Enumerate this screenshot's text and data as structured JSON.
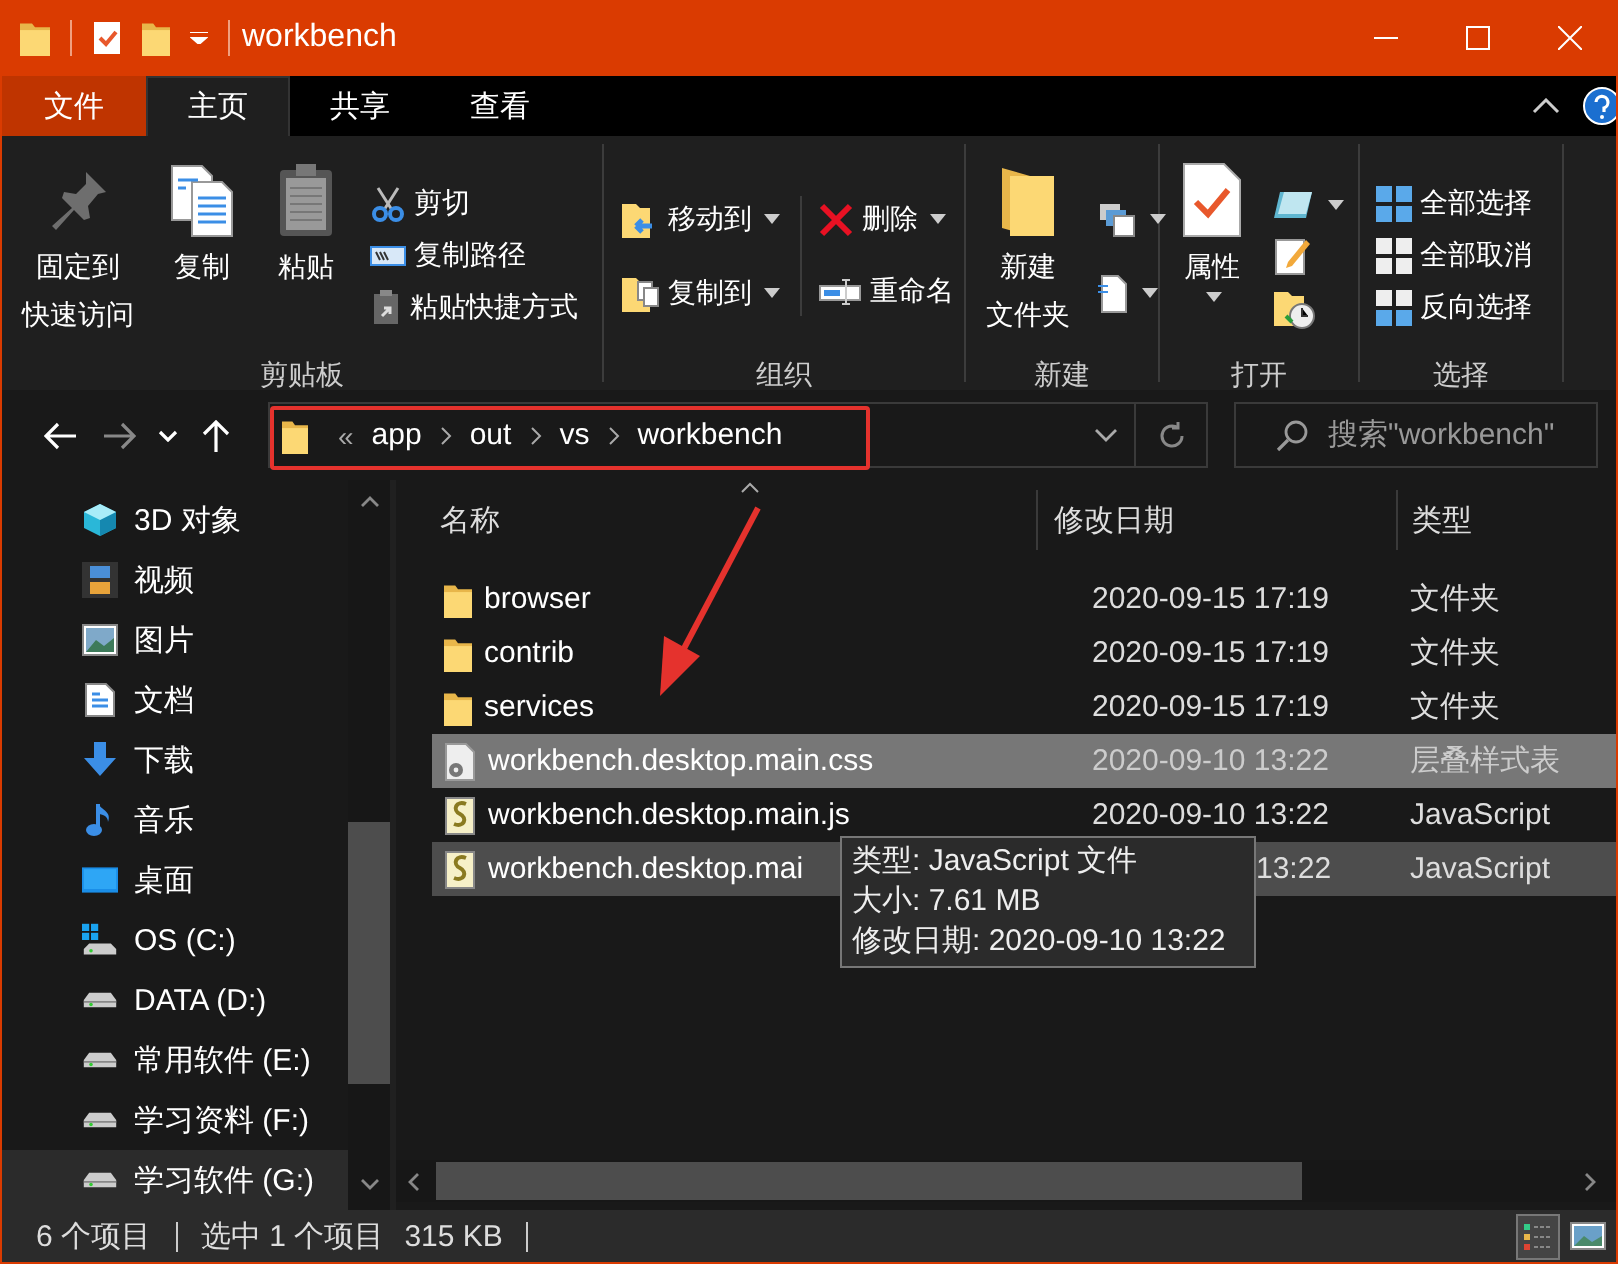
{
  "window": {
    "title": "workbench"
  },
  "ribbon_tabs": [
    {
      "label": "文件",
      "kind": "file",
      "selected": false
    },
    {
      "label": "主页",
      "kind": "tab",
      "selected": true
    },
    {
      "label": "共享",
      "kind": "tab",
      "selected": false
    },
    {
      "label": "查看",
      "kind": "tab",
      "selected": false
    }
  ],
  "ribbon_groups": [
    {
      "label": "剪贴板",
      "items": [
        {
          "kind": "large",
          "label": [
            "固定到",
            "快速访问"
          ],
          "dropdown": false
        },
        {
          "kind": "large",
          "label": [
            "复制"
          ],
          "dropdown": false
        },
        {
          "kind": "large",
          "label": [
            "粘贴"
          ],
          "dropdown": false
        },
        {
          "kind": "stack",
          "items": [
            {
              "label": "剪切",
              "dropdown": false
            },
            {
              "label": "复制路径",
              "dropdown": false
            },
            {
              "label": "粘贴快捷方式",
              "dropdown": false
            }
          ]
        }
      ]
    },
    {
      "label": "组织",
      "items": [
        {
          "kind": "stack",
          "items": [
            {
              "label": "移动到",
              "dropdown": true
            },
            {
              "label": "复制到",
              "dropdown": true
            }
          ]
        },
        {
          "kind": "stack",
          "items": [
            {
              "label": "删除",
              "dropdown": true
            },
            {
              "label": "重命名",
              "dropdown": false
            }
          ]
        }
      ]
    },
    {
      "label": "新建",
      "items": [
        {
          "kind": "large",
          "label": [
            "新建",
            "文件夹"
          ],
          "dropdown": false
        },
        {
          "kind": "stack",
          "items": [
            {
              "dropdown": true
            },
            {
              "dropdown": true
            }
          ]
        }
      ]
    },
    {
      "label": "打开",
      "items": [
        {
          "kind": "large",
          "label": [
            "属性"
          ],
          "dropdown": true
        },
        {
          "kind": "stack",
          "items": [
            {
              "dropdown": true
            },
            {
              "dropdown": false
            },
            {
              "dropdown": false
            }
          ]
        }
      ]
    },
    {
      "label": "选择",
      "items": [
        {
          "kind": "stack",
          "items": [
            {
              "label": "全部选择",
              "dropdown": false
            },
            {
              "label": "全部取消",
              "dropdown": false
            },
            {
              "label": "反向选择",
              "dropdown": false
            }
          ]
        }
      ]
    }
  ],
  "address": {
    "overflow": "«",
    "crumbs": [
      "app",
      "out",
      "vs",
      "workbench"
    ]
  },
  "search": {
    "placeholder": "搜索\"workbench\""
  },
  "sidebar": {
    "items": [
      {
        "label": "3D 对象",
        "hovered": false
      },
      {
        "label": "视频",
        "hovered": false
      },
      {
        "label": "图片",
        "hovered": false
      },
      {
        "label": "文档",
        "hovered": false
      },
      {
        "label": "下载",
        "hovered": false
      },
      {
        "label": "音乐",
        "hovered": false
      },
      {
        "label": "桌面",
        "hovered": false
      },
      {
        "label": "OS (C:)",
        "hovered": false
      },
      {
        "label": "DATA (D:)",
        "hovered": false
      },
      {
        "label": "常用软件 (E:)",
        "hovered": false
      },
      {
        "label": "学习资料 (F:)",
        "hovered": false
      },
      {
        "label": "学习软件 (G:)",
        "hovered": true
      }
    ]
  },
  "columns": [
    "名称",
    "修改日期",
    "类型"
  ],
  "files": [
    {
      "name": "browser",
      "date": "2020-09-15 17:19",
      "type": "文件夹",
      "kind": "folder",
      "selected": false,
      "hovered": false
    },
    {
      "name": "contrib",
      "date": "2020-09-15 17:19",
      "type": "文件夹",
      "kind": "folder",
      "selected": false,
      "hovered": false
    },
    {
      "name": "services",
      "date": "2020-09-15 17:19",
      "type": "文件夹",
      "kind": "folder",
      "selected": false,
      "hovered": false
    },
    {
      "name": "workbench.desktop.main.css",
      "date": "2020-09-10 13:22",
      "type": "层叠样式表",
      "kind": "css",
      "selected": true,
      "hovered": false
    },
    {
      "name": "workbench.desktop.main.js",
      "date": "2020-09-10 13:22",
      "type": "JavaScript",
      "kind": "js",
      "selected": false,
      "hovered": false
    },
    {
      "name": "workbench.desktop.mai",
      "date": "13:22",
      "type": "JavaScript",
      "kind": "js",
      "selected": false,
      "hovered": true
    }
  ],
  "tooltip": [
    "类型: JavaScript 文件",
    "大小: 7.61 MB",
    "修改日期: 2020-09-10 13:22"
  ],
  "status_bar": {
    "item_count": "6 个项目",
    "selection": "选中 1 个项目",
    "size": "315 KB"
  },
  "view_buttons": [
    {
      "kind": "details",
      "selected": true
    },
    {
      "kind": "thumbnails",
      "selected": false
    }
  ]
}
